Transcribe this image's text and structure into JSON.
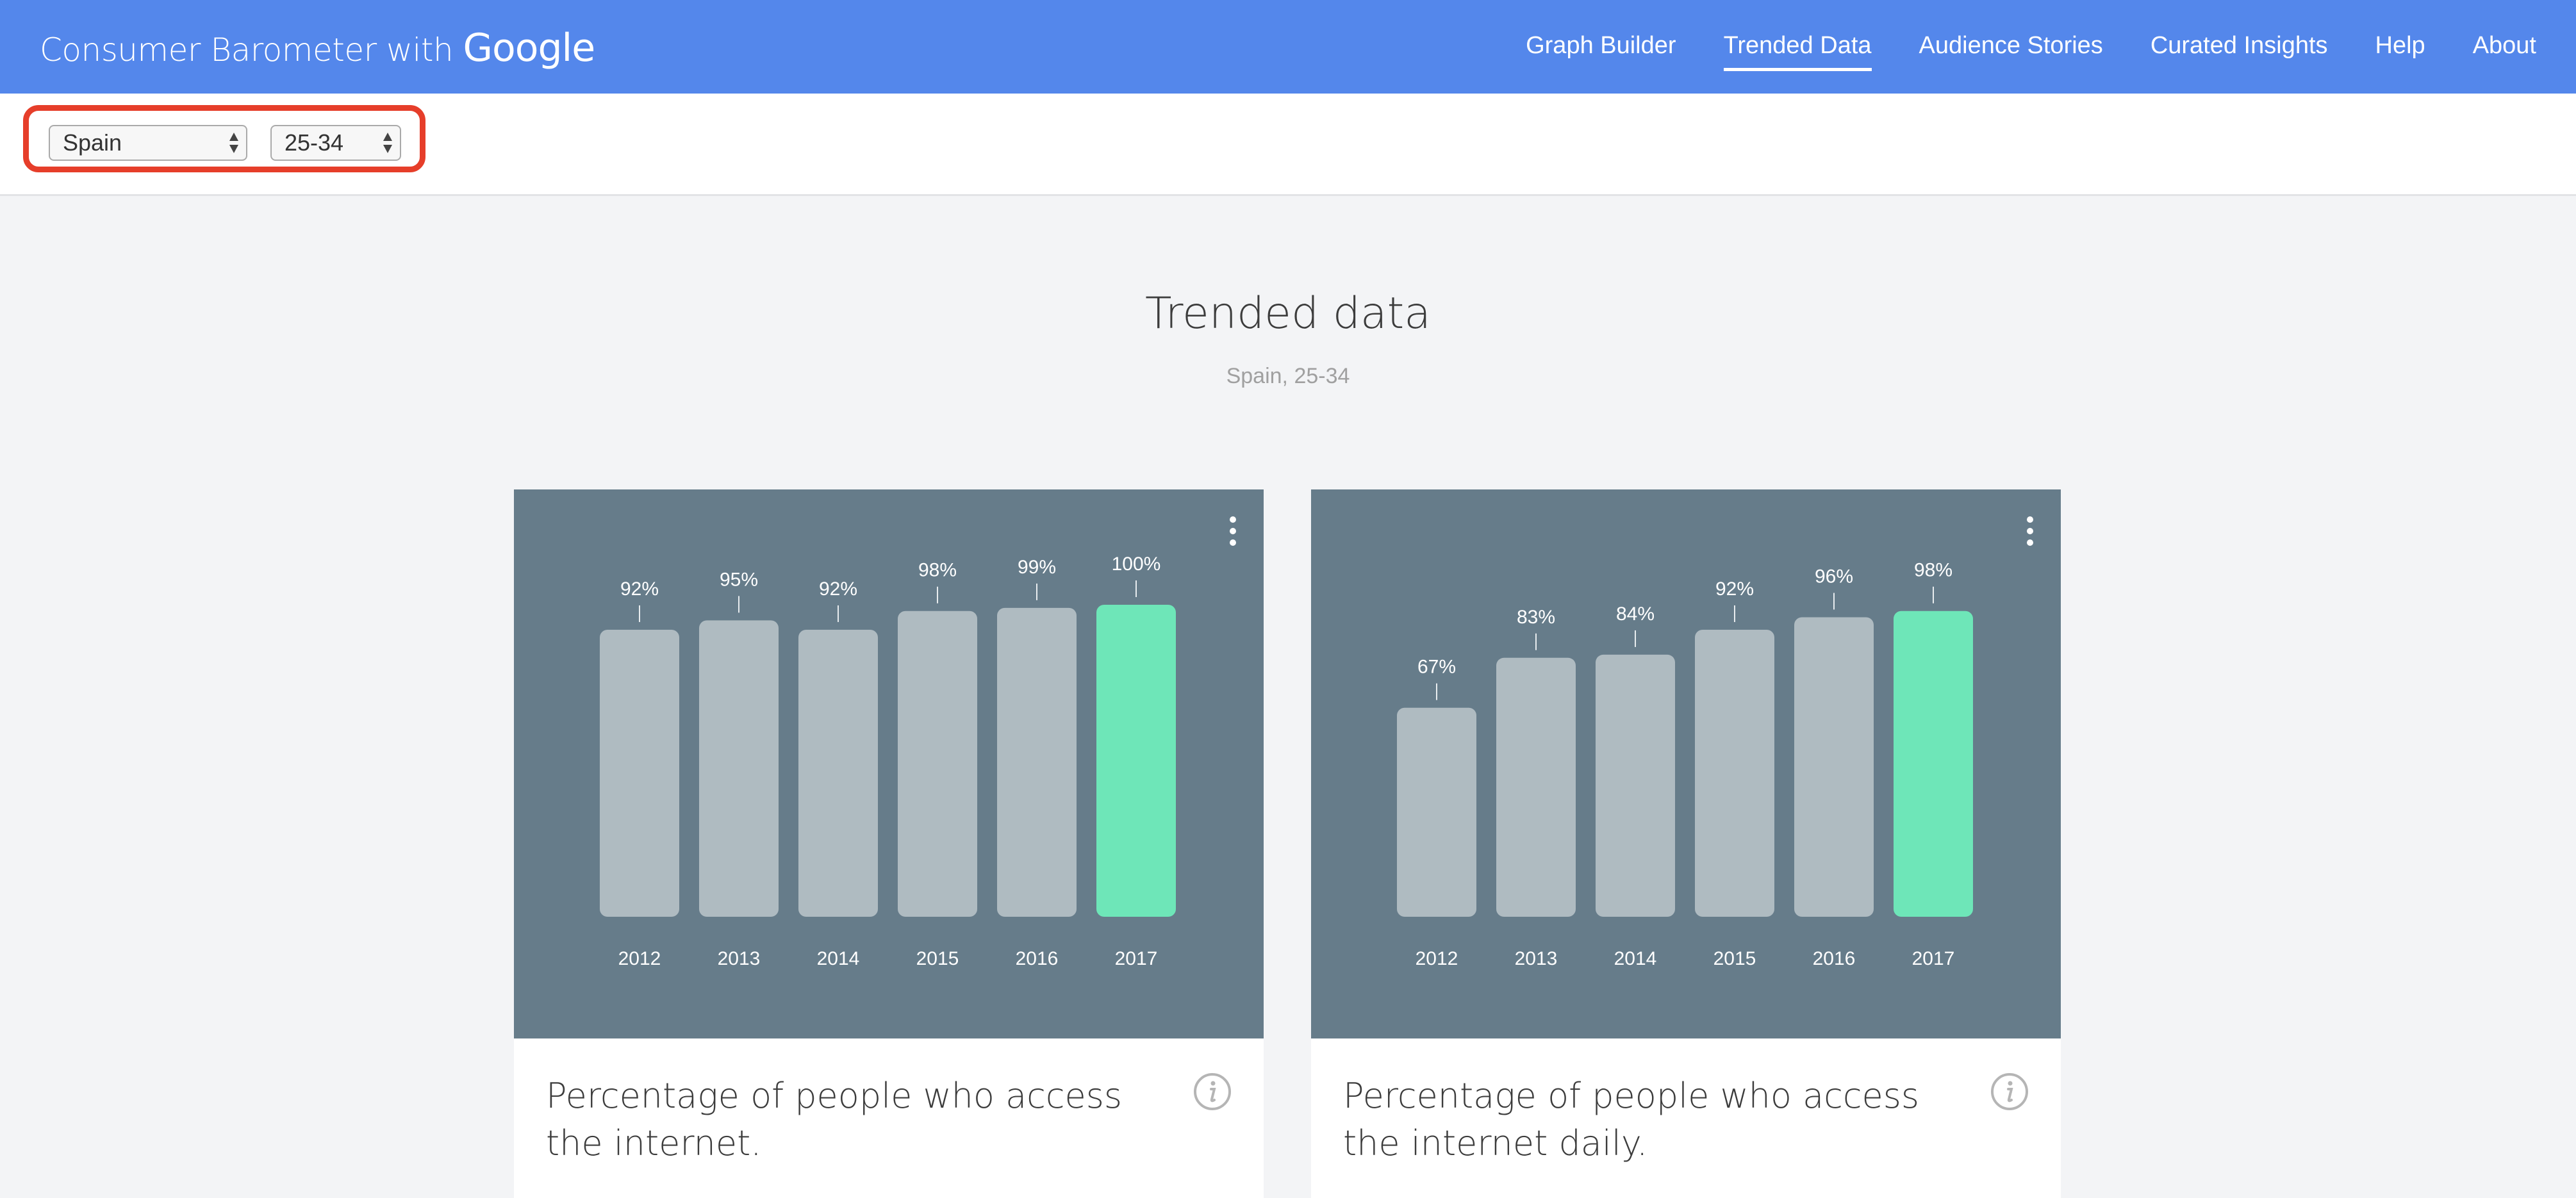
{
  "header": {
    "logo_text": "Consumer Barometer with ",
    "logo_brand": "Google",
    "nav": [
      {
        "label": "Graph Builder",
        "active": false
      },
      {
        "label": "Trended Data",
        "active": true
      },
      {
        "label": "Audience Stories",
        "active": false
      },
      {
        "label": "Curated Insights",
        "active": false
      },
      {
        "label": "Help",
        "active": false
      },
      {
        "label": "About",
        "active": false
      }
    ]
  },
  "filters": {
    "country": "Spain",
    "age": "25-34",
    "highlight_color": "#e63e2a"
  },
  "page": {
    "title": "Trended data",
    "subtitle": "Spain, 25-34"
  },
  "colors": {
    "header_bg": "#5487eb",
    "chart_bg": "#667c8a",
    "bar": "#afbbc1",
    "bar_highlight": "#6ee6b8"
  },
  "chart_data": [
    {
      "type": "bar",
      "title": "Percentage of people who access the internet.",
      "categories": [
        "2012",
        "2013",
        "2014",
        "2015",
        "2016",
        "2017"
      ],
      "values": [
        92,
        95,
        92,
        98,
        99,
        100
      ],
      "labels": [
        "92%",
        "95%",
        "92%",
        "98%",
        "99%",
        "100%"
      ],
      "highlight_index": 5,
      "ylim": [
        0,
        100
      ],
      "xlabel": "",
      "ylabel": "",
      "grid": false
    },
    {
      "type": "bar",
      "title": "Percentage of people who access the internet daily.",
      "categories": [
        "2012",
        "2013",
        "2014",
        "2015",
        "2016",
        "2017"
      ],
      "values": [
        67,
        83,
        84,
        92,
        96,
        98
      ],
      "labels": [
        "67%",
        "83%",
        "84%",
        "92%",
        "96%",
        "98%"
      ],
      "highlight_index": 5,
      "ylim": [
        0,
        100
      ],
      "xlabel": "",
      "ylabel": "",
      "grid": false
    }
  ]
}
